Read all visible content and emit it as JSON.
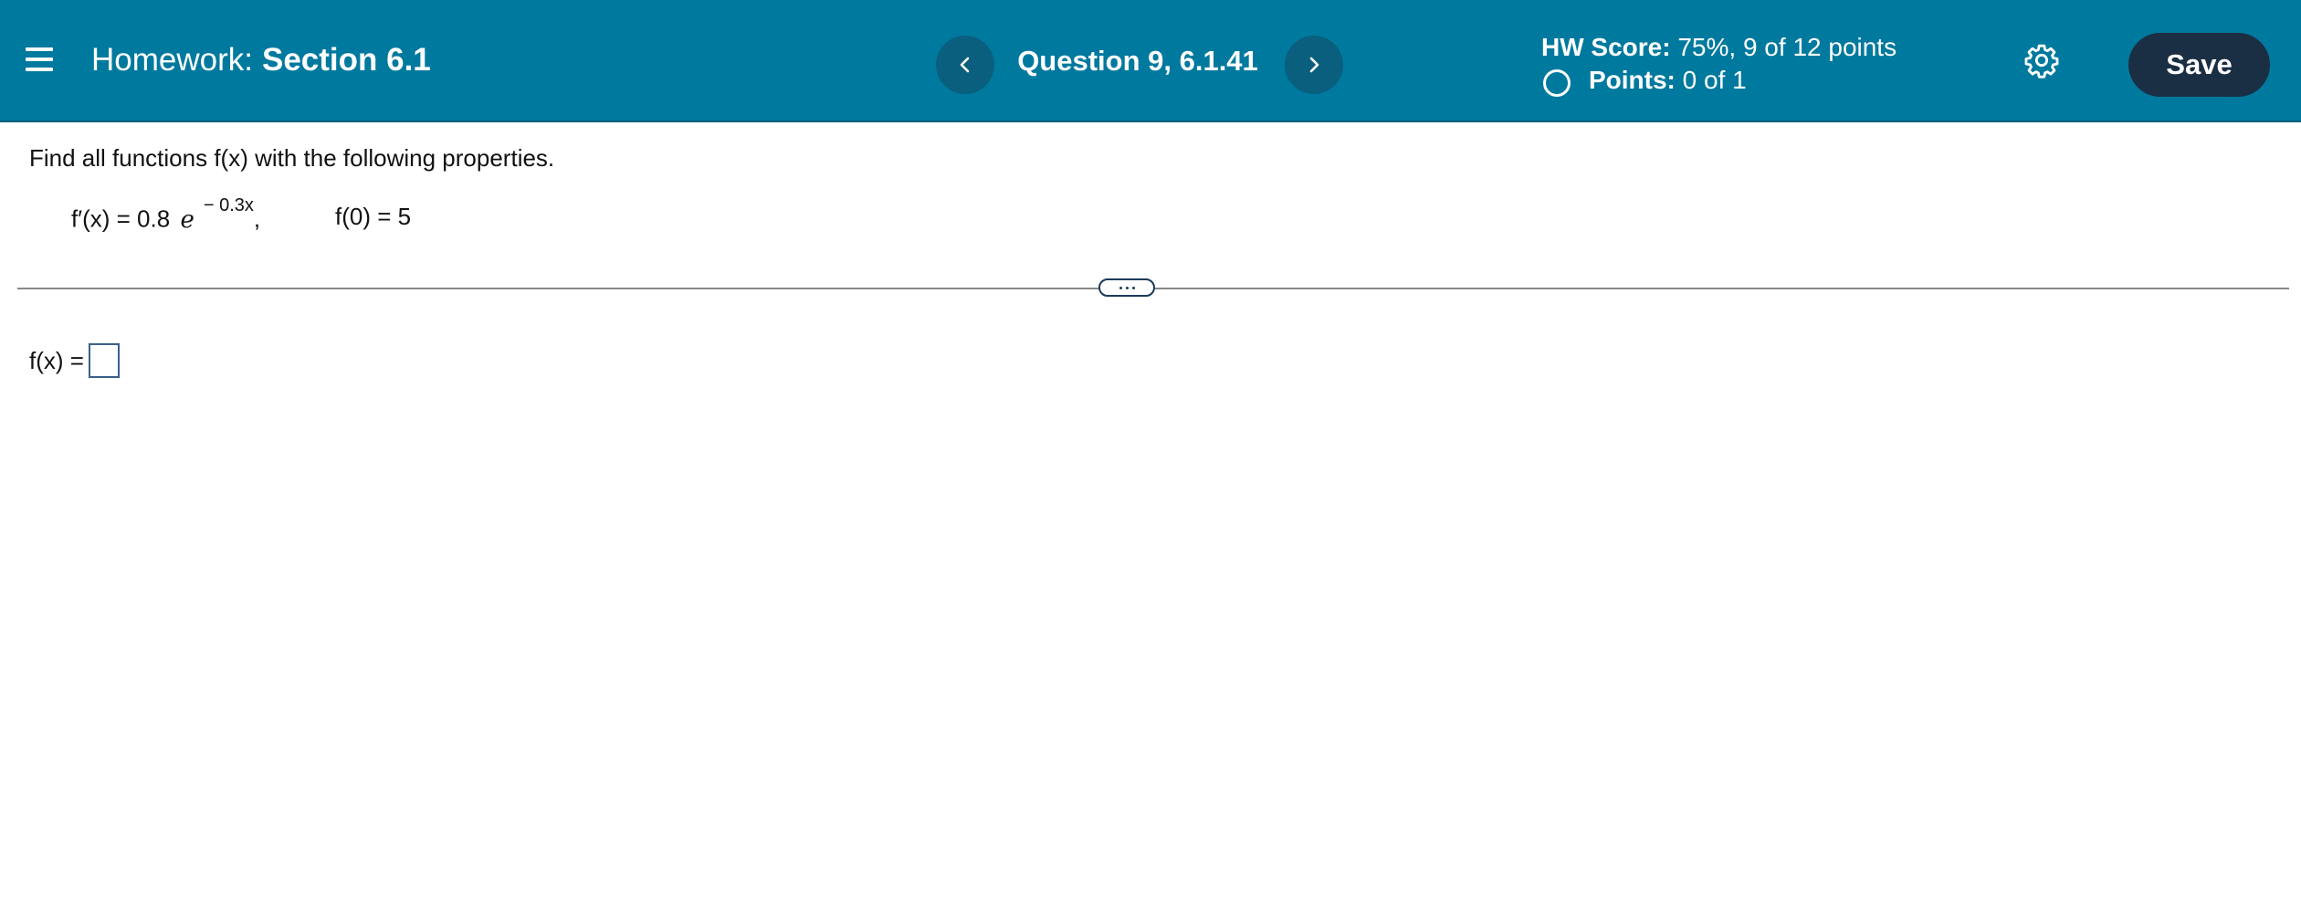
{
  "header": {
    "title_prefix": "Homework:",
    "title_section": "Section 6.1",
    "question_label": "Question 9, 6.1.41",
    "hw_score_label": "HW Score:",
    "hw_score_value": "75%, 9 of 12 points",
    "points_label": "Points:",
    "points_value": "0 of 1",
    "save_label": "Save",
    "bar_color": "#00799e",
    "save_color": "#1a2e44"
  },
  "icons": {
    "menu": "hamburger-menu-icon",
    "prev": "chevron-left-icon",
    "next": "chevron-right-icon",
    "settings": "gear-icon",
    "status": "empty-circle-icon",
    "expand": "more-dots-icon"
  },
  "question": {
    "prompt": "Find all functions f(x) with the following properties.",
    "derivative_lhs": "f′(x) = 0.8",
    "base": "e",
    "exponent": "− 0.3x",
    "separator": ",",
    "initial_condition": "f(0) = 5"
  },
  "answer": {
    "label": "f(x) =",
    "value": ""
  }
}
